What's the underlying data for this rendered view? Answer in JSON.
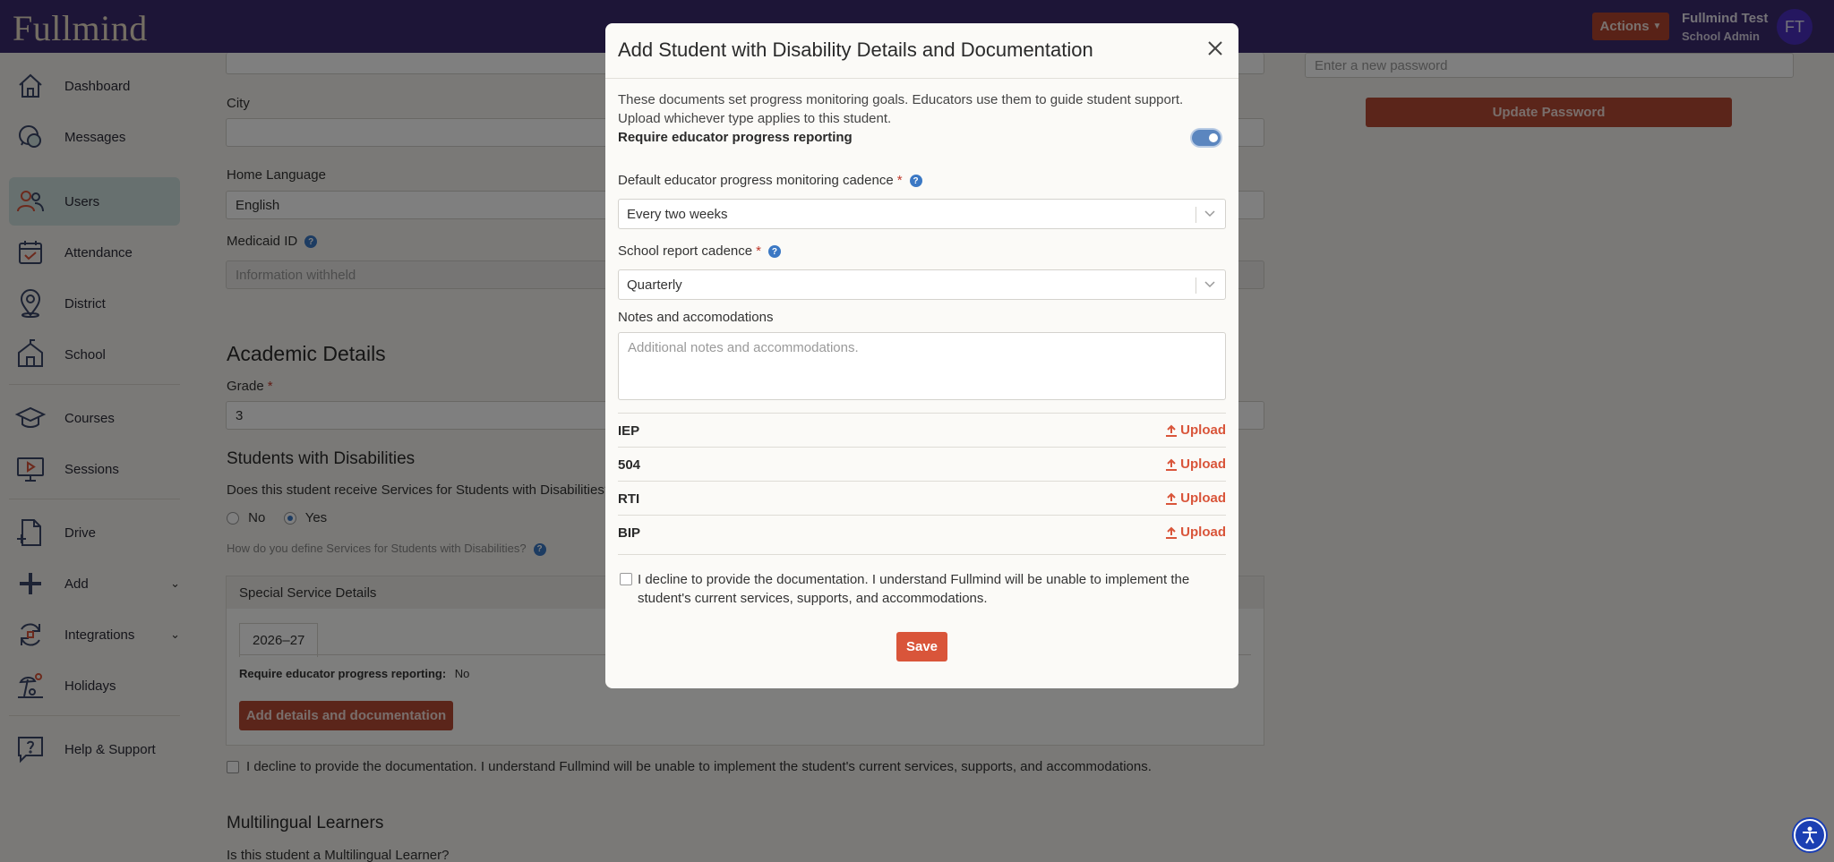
{
  "topbar": {
    "logo": "Fullmind",
    "actions_label": "Actions",
    "user_name": "Fullmind Test",
    "user_role": "School Admin",
    "avatar_initials": "FT"
  },
  "sidebar": {
    "items": [
      {
        "label": "Dashboard",
        "icon": "home-icon"
      },
      {
        "label": "Messages",
        "icon": "chat-icon"
      },
      {
        "label": "Users",
        "icon": "users-icon",
        "active": true
      },
      {
        "label": "Attendance",
        "icon": "calendar-icon"
      },
      {
        "label": "District",
        "icon": "map-pin-icon"
      },
      {
        "label": "School",
        "icon": "school-icon"
      },
      {
        "label": "Courses",
        "icon": "graduation-cap-icon"
      },
      {
        "label": "Sessions",
        "icon": "presentation-icon"
      },
      {
        "label": "Drive",
        "icon": "file-plus-icon"
      },
      {
        "label": "Add",
        "icon": "plus-icon"
      },
      {
        "label": "Integrations",
        "icon": "sync-icon"
      },
      {
        "label": "Holidays",
        "icon": "beach-icon"
      },
      {
        "label": "Help & Support",
        "icon": "help-chat-icon"
      }
    ]
  },
  "form": {
    "city_label": "City",
    "home_language_label": "Home Language",
    "home_language_value": "English",
    "medicaid_label": "Medicaid ID",
    "medicaid_value": "Information withheld",
    "password_placeholder": "Enter a new password",
    "update_password_label": "Update Password",
    "academic_title": "Academic Details",
    "grade_label": "Grade",
    "grade_value": "3",
    "swd_title": "Students with Disabilities",
    "swd_question": "Does this student receive Services for Students with Disabilities?",
    "radio_no": "No",
    "radio_yes": "Yes",
    "swd_hint": "How do you define Services for Students with Disabilities?",
    "ssd_title": "Special Service Details",
    "year_tab": "2026–27",
    "req_reporting_label": "Require educator progress reporting:",
    "req_reporting_value": "No",
    "add_details_label": "Add details and documentation",
    "decline_text": "I decline to provide the documentation. I understand Fullmind will be unable to implement the student's current services, supports, and accommodations.",
    "ml_title": "Multilingual Learners",
    "ml_question": "Is this student a Multilingual Learner?"
  },
  "modal": {
    "title": "Add Student with Disability Details and Documentation",
    "description_line1": "These documents set progress monitoring goals. Educators use them to guide student support.",
    "description_line2": "Upload whichever type applies to this student.",
    "toggle_label": "Require educator progress reporting",
    "toggle_on": true,
    "cadence_label": "Default educator progress monitoring cadence",
    "cadence_value": "Every two weeks",
    "school_report_label": "School report cadence",
    "school_report_value": "Quarterly",
    "notes_label": "Notes and accomodations",
    "notes_placeholder": "Additional notes and accommodations.",
    "documents": [
      {
        "name": "IEP",
        "action": "Upload"
      },
      {
        "name": "504",
        "action": "Upload"
      },
      {
        "name": "RTI",
        "action": "Upload"
      },
      {
        "name": "BIP",
        "action": "Upload"
      }
    ],
    "decline_text": "I decline to provide the documentation. I understand Fullmind will be unable to implement the student's current services, supports, and accommodations.",
    "save_label": "Save"
  },
  "colors": {
    "topbar": "#3a2a6e",
    "accent_red": "#d9553a",
    "active_nav": "#cfe1df",
    "link_blue": "#3b78c4"
  }
}
